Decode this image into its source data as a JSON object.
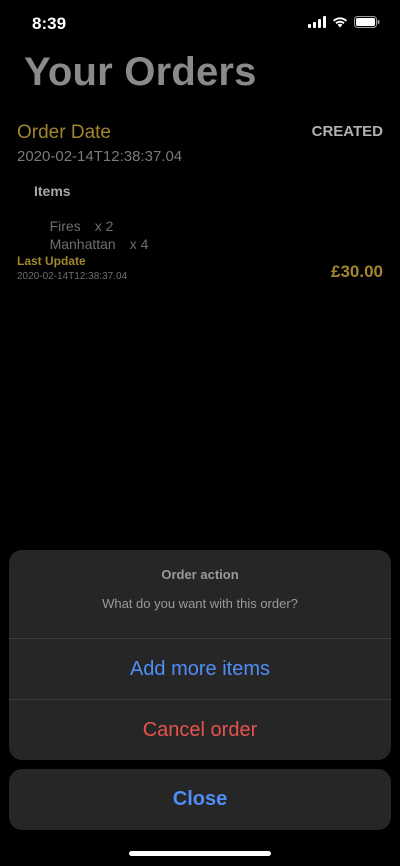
{
  "status_bar": {
    "time": "8:39",
    "icons": [
      "cellular-signal-icon",
      "wifi-icon",
      "battery-icon"
    ]
  },
  "page": {
    "title": "Your Orders"
  },
  "order": {
    "date_label": "Order Date",
    "status": "CREATED",
    "date_value": "2020-02-14T12:38:37.04",
    "items_heading": "Items",
    "items": [
      {
        "name": "Fires",
        "quantity": "x 2"
      },
      {
        "name": "Manhattan",
        "quantity": "x 4"
      }
    ],
    "last_update_label": "Last Update",
    "last_update_value": "2020-02-14T12:38:37.04",
    "total": "£30.00"
  },
  "action_sheet": {
    "title": "Order action",
    "message": "What do you want with this order?",
    "actions": [
      {
        "label": "Add more items",
        "color": "#4f8ef7"
      },
      {
        "label": "Cancel order",
        "color": "#e5534b"
      }
    ],
    "close_label": "Close"
  },
  "colors": {
    "accent_gold": "#a0862f",
    "action_blue": "#4f8ef7",
    "destructive_red": "#e5534b",
    "sheet_bg": "#262626"
  }
}
